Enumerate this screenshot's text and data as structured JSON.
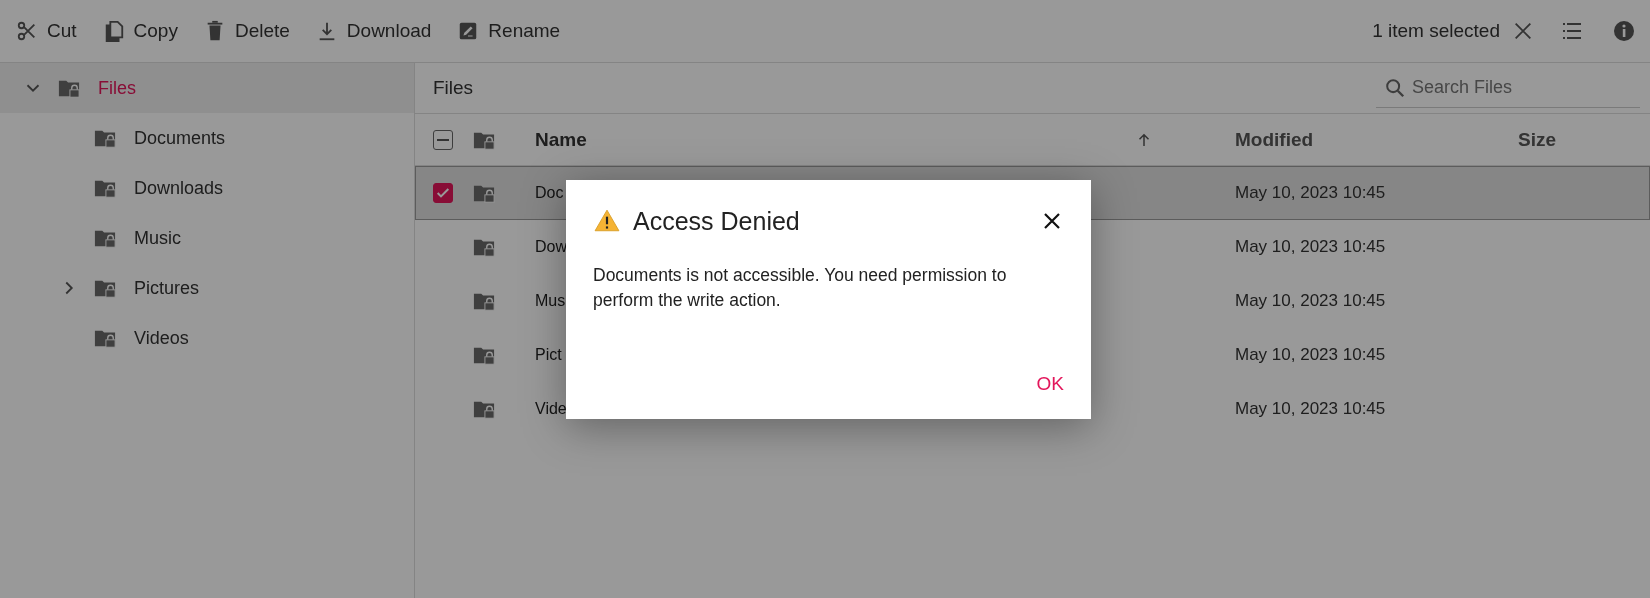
{
  "toolbar": {
    "actions": [
      {
        "label": "Cut"
      },
      {
        "label": "Copy"
      },
      {
        "label": "Delete"
      },
      {
        "label": "Download"
      },
      {
        "label": "Rename"
      }
    ],
    "selection": "1 item selected"
  },
  "tree": {
    "label": "Files",
    "selected": true,
    "expanded": true,
    "children": [
      {
        "label": "Documents",
        "expandable": false,
        "selected": false
      },
      {
        "label": "Downloads",
        "expandable": false,
        "selected": false
      },
      {
        "label": "Music",
        "expandable": false,
        "selected": false
      },
      {
        "label": "Pictures",
        "expandable": true,
        "selected": false
      },
      {
        "label": "Videos",
        "expandable": false,
        "selected": false
      }
    ]
  },
  "breadcrumb": "Files",
  "search": {
    "placeholder": "Search Files"
  },
  "table": {
    "header_checkbox": {
      "indeterminate": true
    },
    "columns": [
      {
        "label": "Name",
        "sorted_ascending": true
      },
      {
        "label": "Modified"
      },
      {
        "label": "Size"
      }
    ],
    "rows": [
      {
        "name": "Doc",
        "modified": "May 10, 2023 10:45",
        "selected": true
      },
      {
        "name": "Dow",
        "modified": "May 10, 2023 10:45",
        "selected": false
      },
      {
        "name": "Mus",
        "modified": "May 10, 2023 10:45",
        "selected": false
      },
      {
        "name": "Pict",
        "modified": "May 10, 2023 10:45",
        "selected": false
      },
      {
        "name": "Vide",
        "modified": "May 10, 2023 10:45",
        "selected": false
      }
    ]
  },
  "dialog": {
    "title": "Access Denied",
    "message": "Documents is not accessible. You need permission to perform the write action.",
    "button": "OK"
  }
}
